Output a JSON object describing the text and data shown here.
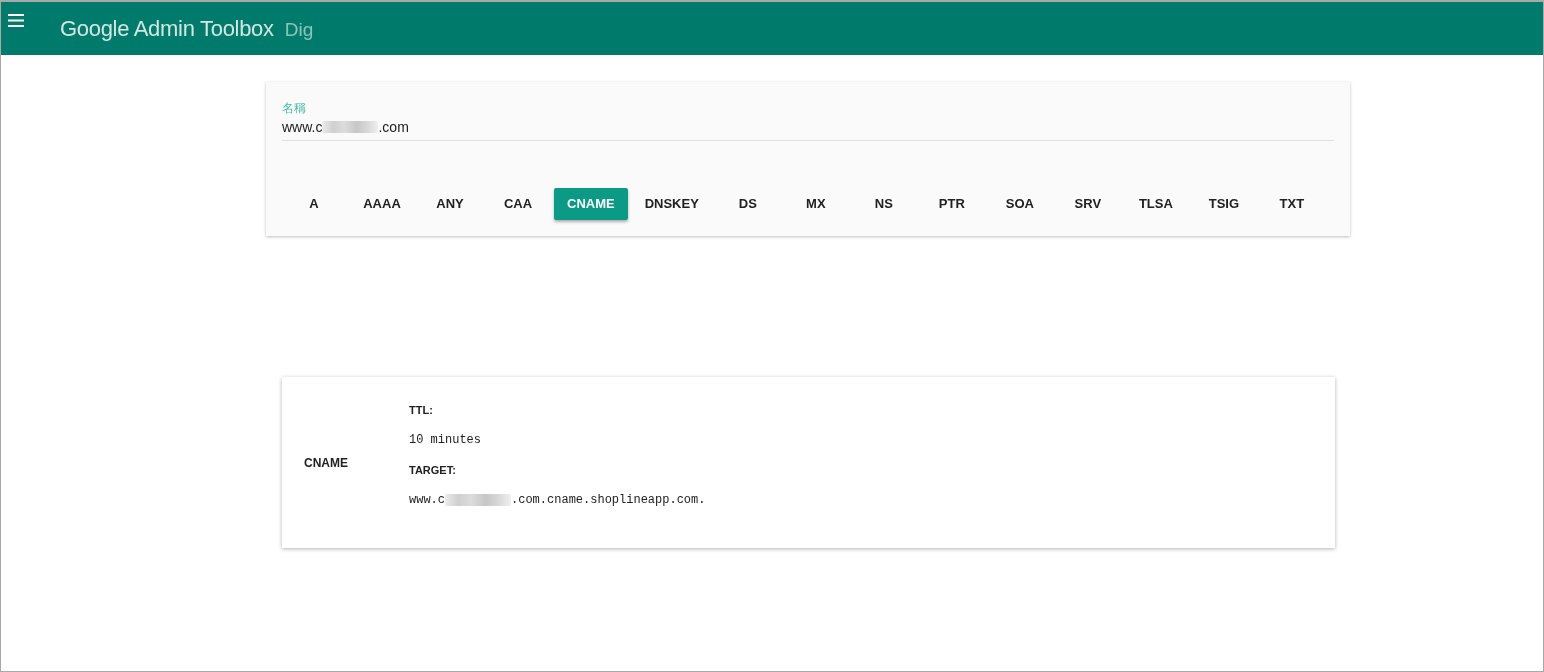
{
  "app_bar": {
    "title": "Google Admin Toolbox",
    "subtitle": "Dig"
  },
  "query": {
    "label": "名稱",
    "value_parts": [
      "www.c",
      ".com"
    ],
    "record_types": [
      {
        "label": "A",
        "selected": false
      },
      {
        "label": "AAAA",
        "selected": false
      },
      {
        "label": "ANY",
        "selected": false
      },
      {
        "label": "CAA",
        "selected": false
      },
      {
        "label": "CNAME",
        "selected": true
      },
      {
        "label": "DNSKEY",
        "selected": false
      },
      {
        "label": "DS",
        "selected": false
      },
      {
        "label": "MX",
        "selected": false
      },
      {
        "label": "NS",
        "selected": false
      },
      {
        "label": "PTR",
        "selected": false
      },
      {
        "label": "SOA",
        "selected": false
      },
      {
        "label": "SRV",
        "selected": false
      },
      {
        "label": "TLSA",
        "selected": false
      },
      {
        "label": "TSIG",
        "selected": false
      },
      {
        "label": "TXT",
        "selected": false
      }
    ]
  },
  "result": {
    "record_type": "CNAME",
    "fields": [
      {
        "label": "TTL:",
        "value_parts": [
          "10 minutes"
        ]
      },
      {
        "label": "TARGET:",
        "value_parts": [
          "www.c",
          ".com.cname.shoplineapp.com."
        ]
      }
    ]
  }
}
